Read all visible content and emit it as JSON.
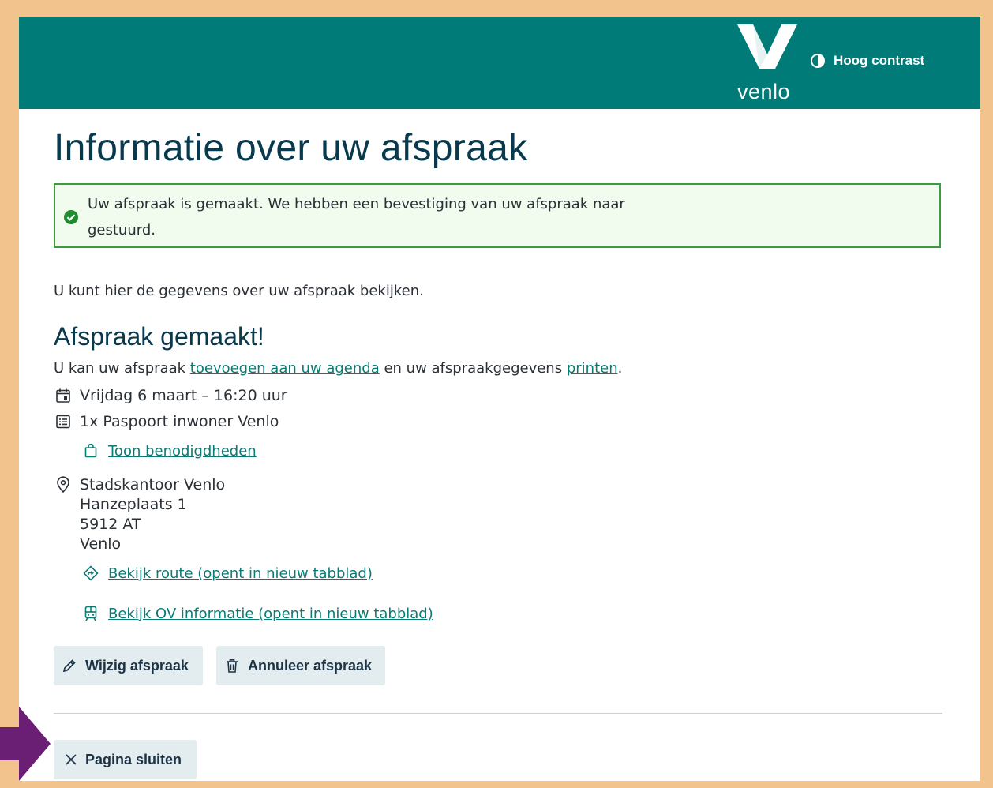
{
  "header": {
    "logo_text": "venlo",
    "contrast_label": "Hoog contrast",
    "contrast_icon": "half-circle-icon",
    "background": "#007b78"
  },
  "page": {
    "title": "Informatie over uw afspraak",
    "alert": {
      "text": "Uw afspraak is gemaakt. We hebben een bevestiging van uw afspraak naar",
      "text_cont": "gestuurd.",
      "icon": "check-circle-icon",
      "border_color": "#3c9b3c"
    },
    "intro": "U kunt hier de gegevens over uw afspraak bekijken.",
    "subtitle": "Afspraak gemaakt!",
    "options": {
      "prefix": "U kan uw afspraak ",
      "agenda_link": "toevoegen aan uw agenda",
      "middle": " en uw afspraakgegevens ",
      "print_link": "printen",
      "suffix": "."
    },
    "details": {
      "date": "Vrijdag 6 maart – 16:20 uur",
      "product": "1x Paspoort inwoner Venlo",
      "requirements_link": "Toon benodigdheden",
      "location": {
        "name": "Stadskantoor Venlo",
        "street": "Hanzeplaats 1",
        "postcode": "5912 AT",
        "city": "Venlo"
      },
      "route_link": "Bekijk route (opent in nieuw tabblad)",
      "ov_link": "Bekijk OV informatie (opent in nieuw tabblad)"
    },
    "actions": {
      "edit_label": "Wijzig afspraak",
      "cancel_label": "Annuleer afspraak"
    },
    "close_label": "Pagina sluiten"
  },
  "colors": {
    "accent": "#007b78",
    "link": "#0a7a74",
    "heading": "#09394c",
    "arrow": "#6b1f74"
  }
}
